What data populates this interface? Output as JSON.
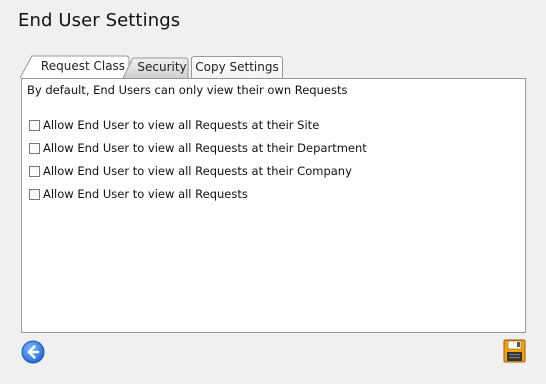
{
  "page": {
    "title": "End User Settings"
  },
  "tabs": [
    {
      "label": "Request Class",
      "active": true
    },
    {
      "label": "Security",
      "active": false
    },
    {
      "label": "Copy Settings",
      "active": false
    }
  ],
  "panel": {
    "intro": "By default, End Users can only view their own Requests",
    "options": [
      {
        "label": "Allow End User to view all Requests at their Site",
        "checked": false
      },
      {
        "label": "Allow End User to view all Requests at their Department",
        "checked": false
      },
      {
        "label": "Allow End User to view all Requests at their Company",
        "checked": false
      },
      {
        "label": "Allow End User to view all Requests",
        "checked": false
      }
    ]
  },
  "footer": {
    "back_icon": "back-arrow-icon",
    "save_icon": "save-disk-icon"
  },
  "colors": {
    "back_blue": "#2f7de0",
    "save_orange": "#f3a316",
    "border": "#9a9a9a"
  }
}
